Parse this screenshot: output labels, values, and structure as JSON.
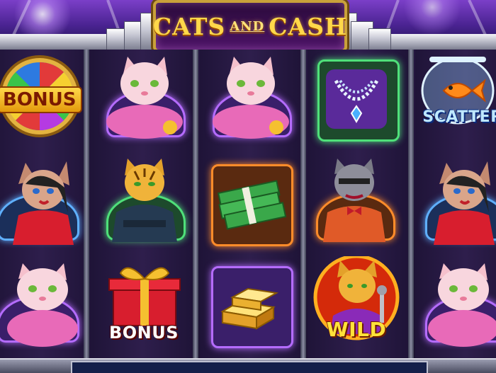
{
  "game": {
    "title_left": "CATS",
    "title_mid": "AND",
    "title_right": "CASH"
  },
  "reels": [
    {
      "symbols": [
        {
          "name": "bonus-wheel",
          "label": "BONUS"
        },
        {
          "name": "lady-cat-red-dress",
          "label": ""
        },
        {
          "name": "pink-persian-cat",
          "label": ""
        }
      ]
    },
    {
      "symbols": [
        {
          "name": "pink-persian-cat",
          "label": ""
        },
        {
          "name": "tiger-cat-suit",
          "label": ""
        },
        {
          "name": "bonus-gift",
          "label": "BONUS"
        }
      ]
    },
    {
      "symbols": [
        {
          "name": "pink-persian-cat",
          "label": ""
        },
        {
          "name": "cash-stack",
          "label": ""
        },
        {
          "name": "gold-bars",
          "label": ""
        }
      ]
    },
    {
      "symbols": [
        {
          "name": "diamond-necklace",
          "label": ""
        },
        {
          "name": "grey-cat-bowtie",
          "label": ""
        },
        {
          "name": "wild-cat-singer",
          "label": "WILD"
        }
      ]
    },
    {
      "symbols": [
        {
          "name": "goldfish-bowl",
          "label": "SCATTER"
        },
        {
          "name": "lady-cat-red-dress",
          "label": ""
        },
        {
          "name": "pink-persian-cat",
          "label": ""
        }
      ]
    }
  ],
  "colors": {
    "frame_gold": "#c9a13a",
    "title_yellow": "#ffd84a",
    "reel_bg": "#251640"
  }
}
